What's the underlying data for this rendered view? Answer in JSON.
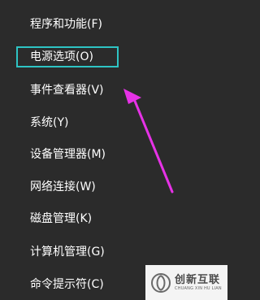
{
  "menu": {
    "items": [
      {
        "label": "程序和功能(F)"
      },
      {
        "label": "电源选项(O)"
      },
      {
        "label": "事件查看器(V)"
      },
      {
        "label": "系统(Y)"
      },
      {
        "label": "设备管理器(M)"
      },
      {
        "label": "网络连接(W)"
      },
      {
        "label": "磁盘管理(K)"
      },
      {
        "label": "计算机管理(G)"
      },
      {
        "label": "命令提示符(C)"
      }
    ]
  },
  "highlight": {
    "color": "#2ec4c4",
    "target": "电源选项(O)"
  },
  "annotation_arrow": {
    "color": "#e632e6"
  },
  "watermark": {
    "title": "创新互联",
    "subtitle": "CHUANG XIN HU LIAN",
    "icon": "swirl-logo-icon"
  },
  "colors": {
    "background": "#2b2b2b",
    "text": "#ffffff"
  }
}
